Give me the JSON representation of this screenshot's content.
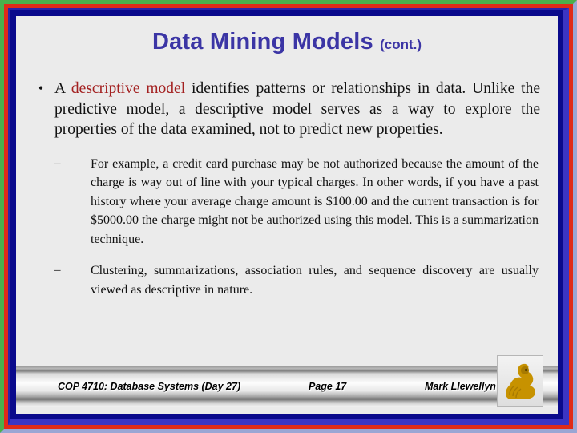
{
  "slide": {
    "title_main": "Data Mining Models",
    "title_suffix": "(cont.)",
    "background_color": "#ebebeb",
    "title_color": "#3b35a5",
    "highlight_color": "#a32020"
  },
  "frame": {
    "outer_top_left_color": "#4bb04b",
    "outer_bottom_right_color": "#9aa6d4",
    "red_color": "#e02b18",
    "blue_color": "#3b35c4",
    "navy_color": "#0a0a8c"
  },
  "content": {
    "level1": {
      "bullet_glyph": "•",
      "text_lead": "A ",
      "text_highlight": "descriptive model",
      "text_rest": " identifies patterns or relationships in data.  Unlike the predictive model, a descriptive model serves as a way to explore the properties of the data examined, not to predict new properties."
    },
    "level2": [
      {
        "bullet_glyph": "–",
        "text": "For example, a credit card purchase may be not authorized because the amount of the charge is way out of line with your typical charges.  In other words, if you have a past history where your average charge amount is $100.00 and the current transaction is for $5000.00 the charge might not be authorized using this model.   This is a summarization technique."
      },
      {
        "bullet_glyph": "–",
        "text": "Clustering, summarizations, association rules, and sequence discovery are usually viewed as descriptive in nature."
      }
    ]
  },
  "footer": {
    "course": "COP 4710: Database Systems  (Day 27)",
    "page": "Page 17",
    "author": "Mark Llewellyn ©",
    "logo_name": "ucf-pegasus-logo",
    "logo_color": "#c79200"
  }
}
